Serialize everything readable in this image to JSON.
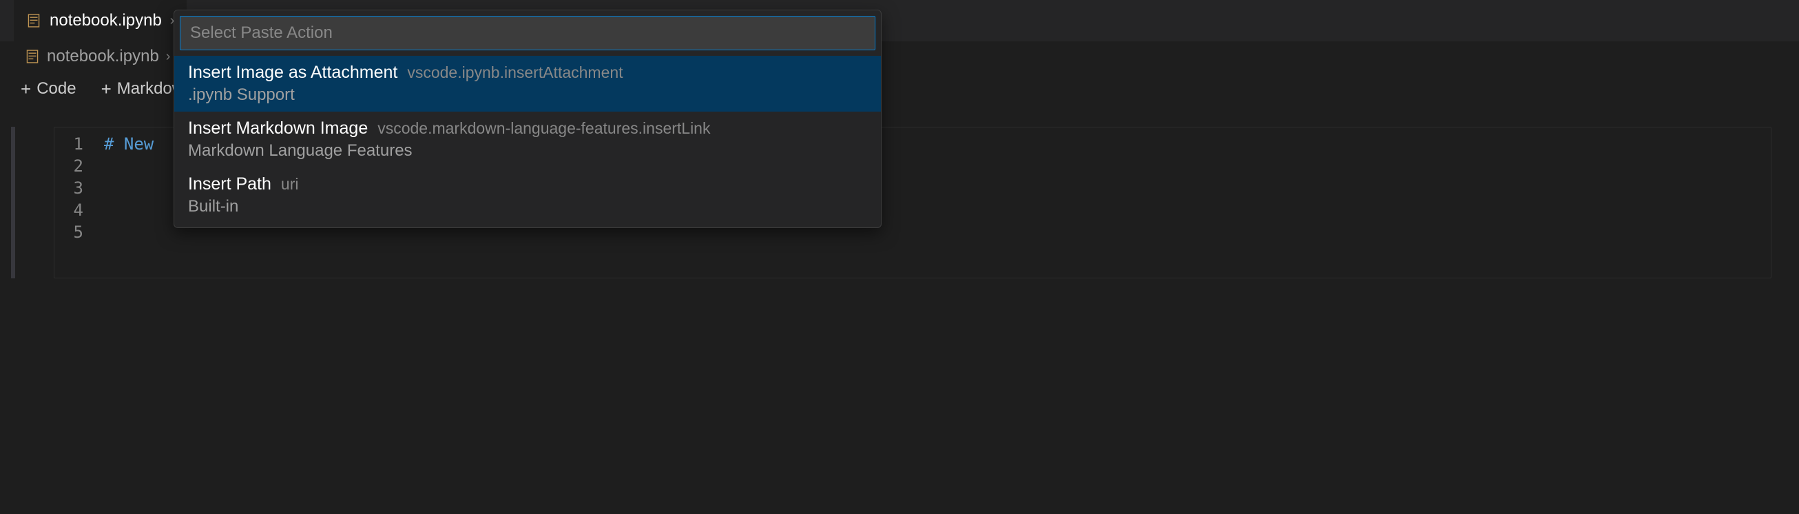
{
  "tabs": {
    "active": {
      "label": "notebook.ipynb"
    }
  },
  "breadcrumb": {
    "items": [
      {
        "label": "notebook.ipynb"
      }
    ]
  },
  "toolbar": {
    "code_label": "Code",
    "markdown_label": "Markdown"
  },
  "editor": {
    "lines": [
      {
        "number": "1",
        "content": "# New"
      },
      {
        "number": "2",
        "content": ""
      },
      {
        "number": "3",
        "content": ""
      },
      {
        "number": "4",
        "content": ""
      },
      {
        "number": "5",
        "content": ""
      }
    ]
  },
  "quickpick": {
    "placeholder": "Select Paste Action",
    "items": [
      {
        "label": "Insert Image as Attachment",
        "description": "vscode.ipynb.insertAttachment",
        "detail": ".ipynb Support",
        "selected": true
      },
      {
        "label": "Insert Markdown Image",
        "description": "vscode.markdown-language-features.insertLink",
        "detail": "Markdown Language Features",
        "selected": false
      },
      {
        "label": "Insert Path",
        "description": "uri",
        "detail": "Built-in",
        "selected": false
      }
    ]
  }
}
